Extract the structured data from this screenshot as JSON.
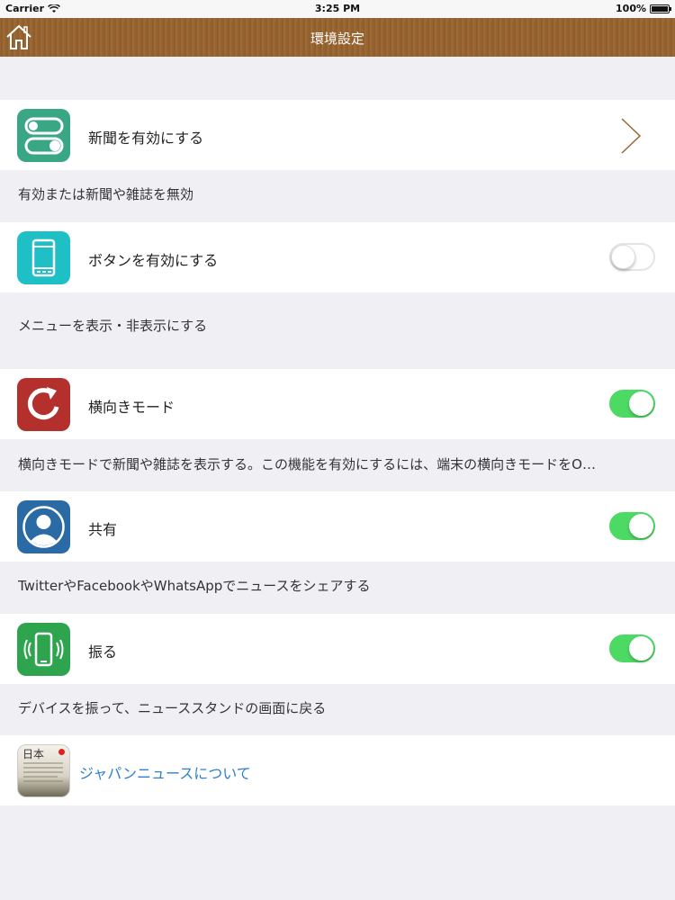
{
  "status_bar": {
    "carrier": "Carrier",
    "time": "3:25 PM",
    "battery": "100%"
  },
  "nav": {
    "title": "環境設定"
  },
  "rows": [
    {
      "label": "新聞を有効にする",
      "description": "有効または新聞や雑誌を無効",
      "control": "chevron"
    },
    {
      "label": "ボタンを有効にする",
      "description": "メニューを表示・非表示にする",
      "control": "toggle",
      "on": false
    },
    {
      "label": "横向きモード",
      "description": "横向きモードで新聞や雑誌を表示する。この機能を有効にするには、端末の横向きモードをO…",
      "control": "toggle",
      "on": true
    },
    {
      "label": "共有",
      "description": "TwitterやFacebookやWhatsAppでニュースをシェアする",
      "control": "toggle",
      "on": true
    },
    {
      "label": "振る",
      "description": "デバイスを振って、ニューススタンドの画面に戻る",
      "control": "toggle",
      "on": true
    },
    {
      "label": "ジャパンニュースについて",
      "icon_text": "日本",
      "control": "link"
    }
  ],
  "colors": {
    "nav_brown": "#9a6733",
    "toggle_on": "#4cd964",
    "link_blue": "#2f7fd0",
    "icon_switch": "#3aa784",
    "icon_phone": "#1fbfc6",
    "icon_rotate": "#b3302c",
    "icon_share": "#2a6aa5",
    "icon_shake": "#2ea44f"
  }
}
